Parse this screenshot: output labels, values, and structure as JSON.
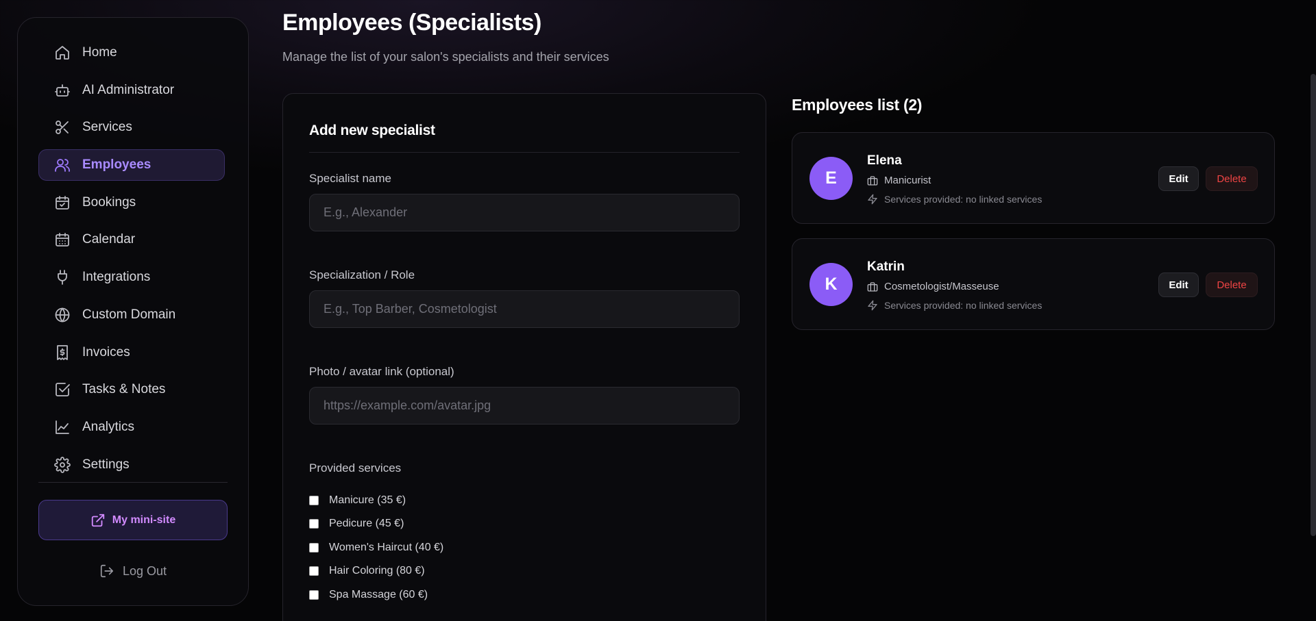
{
  "sidebar": {
    "items": [
      {
        "label": "Home",
        "icon": "home-icon"
      },
      {
        "label": "AI Administrator",
        "icon": "robot-icon"
      },
      {
        "label": "Services",
        "icon": "scissors-icon"
      },
      {
        "label": "Employees",
        "icon": "users-icon",
        "active": true
      },
      {
        "label": "Bookings",
        "icon": "calendar-check-icon"
      },
      {
        "label": "Calendar",
        "icon": "calendar-icon"
      },
      {
        "label": "Integrations",
        "icon": "plug-icon"
      },
      {
        "label": "Custom Domain",
        "icon": "globe-icon"
      },
      {
        "label": "Invoices",
        "icon": "receipt-icon"
      },
      {
        "label": "Tasks & Notes",
        "icon": "checkbox-icon"
      },
      {
        "label": "Analytics",
        "icon": "chart-line-icon"
      },
      {
        "label": "Settings",
        "icon": "gear-icon"
      }
    ],
    "minisite_label": "My mini-site",
    "logout_label": "Log Out"
  },
  "header": {
    "title": "Employees (Specialists)",
    "subtitle": "Manage the list of your salon's specialists and their services"
  },
  "form": {
    "title": "Add new specialist",
    "name_label": "Specialist name",
    "name_placeholder": "E.g., Alexander",
    "role_label": "Specialization / Role",
    "role_placeholder": "E.g., Top Barber, Cosmetologist",
    "photo_label": "Photo / avatar link (optional)",
    "photo_placeholder": "https://example.com/avatar.jpg",
    "services_label": "Provided services",
    "services": [
      "Manicure (35 €)",
      "Pedicure (45 €)",
      "Women's Haircut (40 €)",
      "Hair Coloring (80 €)",
      "Spa Massage (60 €)"
    ]
  },
  "employees": {
    "title": "Employees list (2)",
    "edit_label": "Edit",
    "delete_label": "Delete",
    "list": [
      {
        "initial": "E",
        "name": "Elena",
        "role": "Manicurist",
        "services": "Services provided: no linked services"
      },
      {
        "initial": "K",
        "name": "Katrin",
        "role": "Cosmetologist/Masseuse",
        "services": "Services provided: no linked services"
      }
    ]
  },
  "colors": {
    "accent": "#8b5cf6",
    "active_nav_text": "#a98bff",
    "delete_text": "#ef4444",
    "minisite_text": "#d28bff"
  }
}
